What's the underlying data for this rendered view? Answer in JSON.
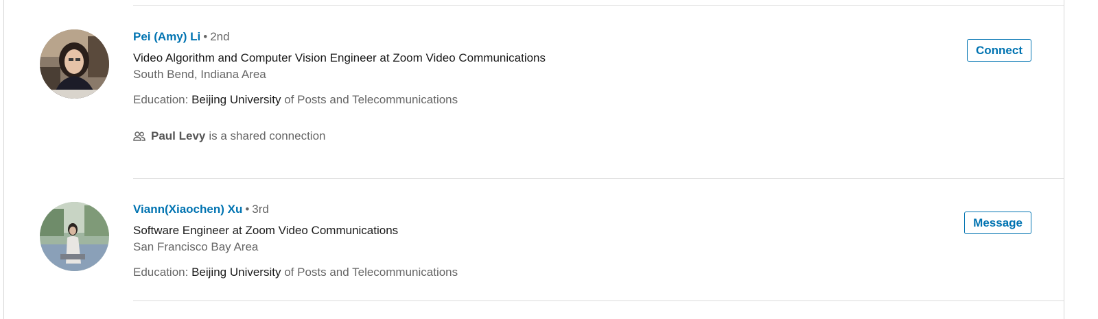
{
  "results": [
    {
      "name": "Pei (Amy) Li",
      "bullet": "•",
      "degree": "2nd",
      "headline": "Video Algorithm and Computer Vision Engineer at Zoom Video Communications",
      "location": "South Bend, Indiana Area",
      "education_label": "Education:",
      "education_highlight": "Beijing University",
      "education_rest": "of Posts and Telecommunications",
      "shared_connection_name": "Paul Levy",
      "shared_connection_text": "is a shared connection",
      "action_label": "Connect",
      "avatar_icon": "profile-photo"
    },
    {
      "name": "Viann(Xiaochen) Xu",
      "bullet": "•",
      "degree": "3rd",
      "headline": "Software Engineer at Zoom Video Communications",
      "location": "San Francisco Bay Area",
      "education_label": "Education:",
      "education_highlight": "Beijing University",
      "education_rest": "of Posts and Telecommunications",
      "action_label": "Message",
      "avatar_icon": "profile-photo"
    }
  ],
  "colors": {
    "link": "#0073b1",
    "muted_text": "#666666",
    "primary_text": "#1a1a1a",
    "divider": "#d9d9d9"
  },
  "icons": {
    "shared_connection": "people-icon"
  }
}
